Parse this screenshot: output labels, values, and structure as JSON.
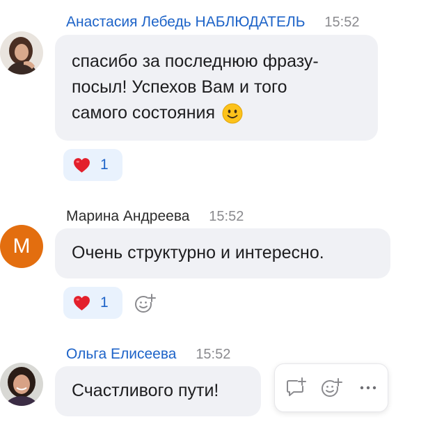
{
  "messages": [
    {
      "author": "Анастасия Лебедь НАБЛЮДАТЕЛЬ",
      "time": "15:52",
      "lines": [
        "спасибо за последнюю фразу-",
        "посыл! Успехов Вам и того",
        "самого состояния"
      ],
      "emoji": "smiling-face-emoji",
      "reaction": {
        "emoji": "heart",
        "count": "1"
      }
    },
    {
      "author": "Марина Андреева",
      "avatar_letter": "М",
      "time": "15:52",
      "lines": [
        "Очень структурно и интересно."
      ],
      "reaction": {
        "emoji": "heart",
        "count": "1"
      }
    },
    {
      "author": "Ольга Елисеева",
      "time": "15:52",
      "lines": [
        "Счастливого пути!"
      ]
    }
  ],
  "colors": {
    "link_blue": "#1d63c8",
    "bubble_bg": "#f0f1f5",
    "reaction_bg": "#e9f2fd",
    "avatar_orange": "#e36e0f"
  },
  "icons": [
    "add-reaction-icon",
    "reply-icon",
    "more-icon"
  ]
}
